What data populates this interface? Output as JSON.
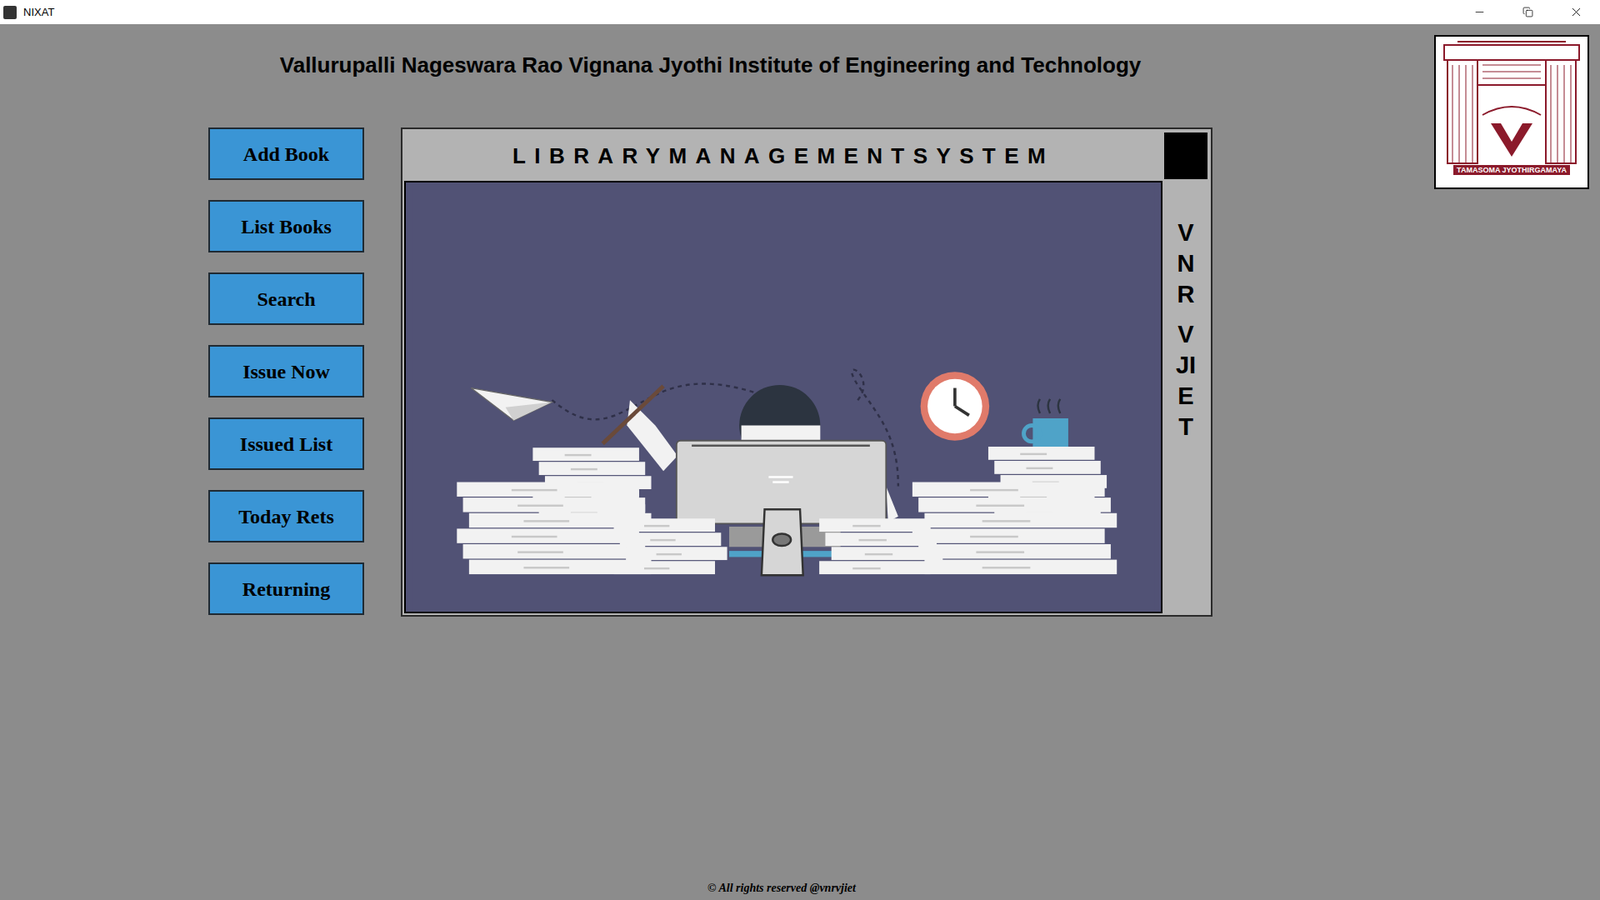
{
  "window": {
    "title": "NIXAT"
  },
  "heading": "Vallurupalli Nageswara Rao Vignana Jyothi Institute of Engineering and Technology",
  "logo": {
    "motto": "TAMASOMA JYOTHIRGAMAYA"
  },
  "buttons": [
    "Add Book",
    "List Books",
    "Search",
    "Issue Now",
    "Issued List",
    "Today Rets",
    "Returning"
  ],
  "panel": {
    "title": "LIBRARYMANAGEMENTSYSTEM",
    "side_text": [
      "VNR",
      "VJIET"
    ]
  },
  "footer": "© All rights reserved @vnrvjiet"
}
